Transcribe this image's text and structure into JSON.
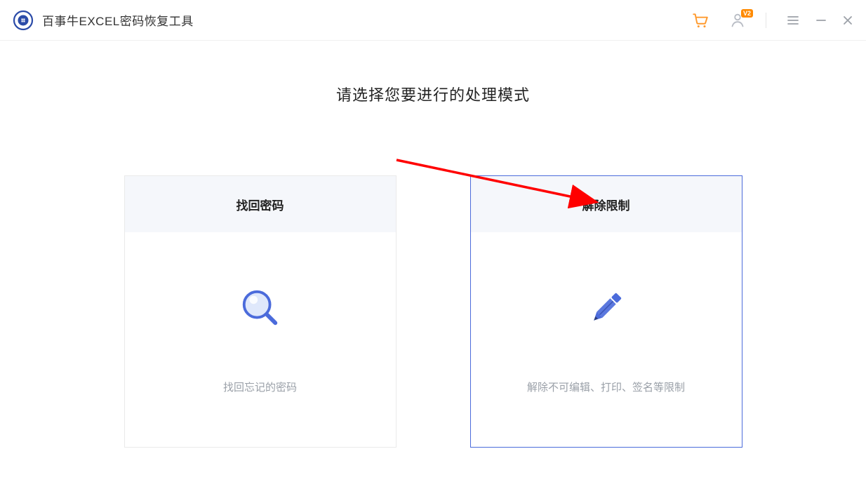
{
  "app": {
    "title": "百事牛EXCEL密码恢复工具"
  },
  "titlebar": {
    "user_badge": "V2"
  },
  "main": {
    "heading": "请选择您要进行的处理模式"
  },
  "cards": {
    "recover": {
      "title": "找回密码",
      "desc": "找回忘记的密码"
    },
    "remove": {
      "title": "解除限制",
      "desc": "解除不可编辑、打印、签名等限制"
    }
  }
}
